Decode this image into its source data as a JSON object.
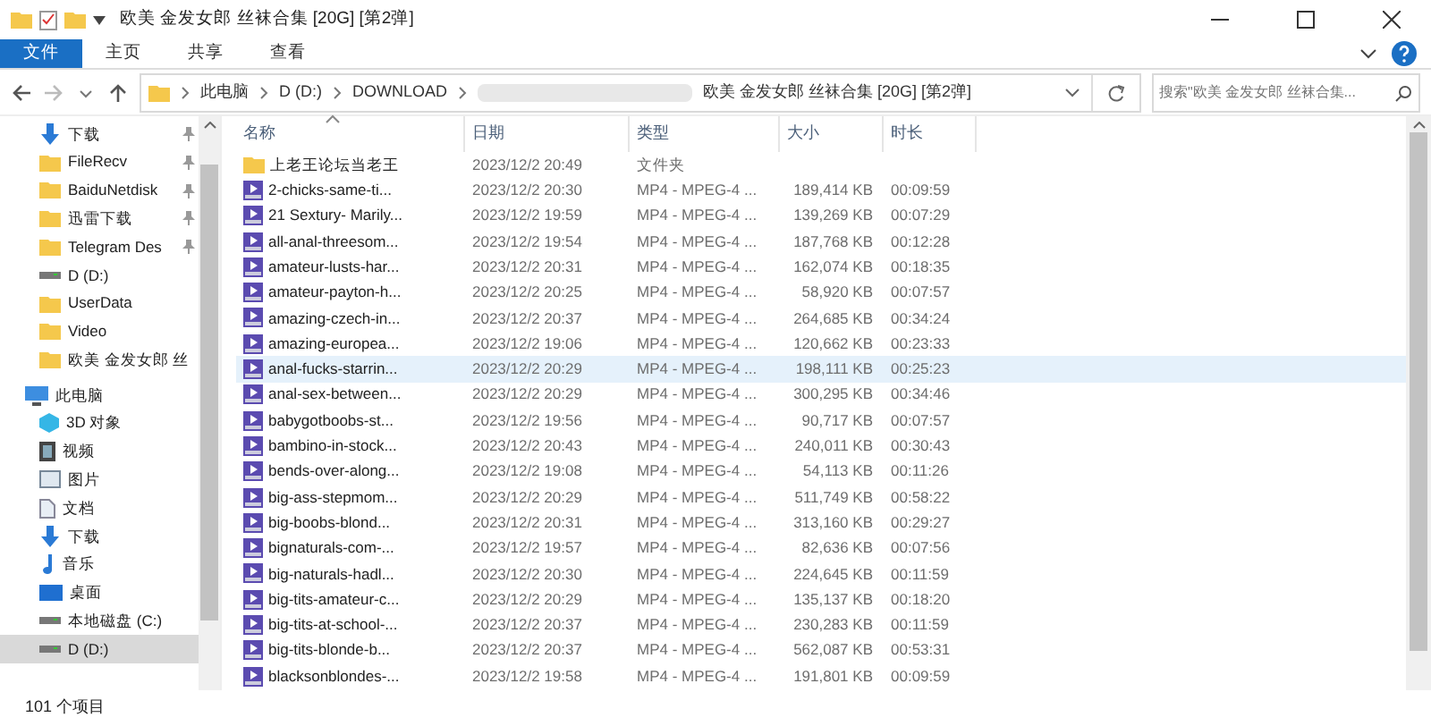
{
  "window": {
    "title": "欧美 金发女郎 丝袜合集 [20G] [第2弹]"
  },
  "ribbon_tabs": [
    {
      "label": "文件",
      "selected": true
    },
    {
      "label": "主页",
      "selected": false
    },
    {
      "label": "共享",
      "selected": false
    },
    {
      "label": "查看",
      "selected": false
    }
  ],
  "address": {
    "crumbs": [
      "此电脑",
      "D (D:)",
      "DOWNLOAD",
      "欧美 金发女郎 丝袜合集 [20G] [第2弹]"
    ]
  },
  "search": {
    "placeholder": "搜索\"欧美 金发女郎 丝袜合集..."
  },
  "sidebar": {
    "items": [
      {
        "label": "下载",
        "kind": "download",
        "pinned": true,
        "selected": false
      },
      {
        "label": "FileRecv",
        "kind": "folder",
        "pinned": true,
        "selected": false
      },
      {
        "label": "BaiduNetdisk",
        "kind": "folder",
        "pinned": true,
        "selected": false
      },
      {
        "label": "迅雷下载",
        "kind": "folder",
        "pinned": true,
        "selected": false
      },
      {
        "label": "Telegram Des",
        "kind": "folder",
        "pinned": true,
        "selected": false
      },
      {
        "label": "D (D:)",
        "kind": "drive",
        "pinned": false,
        "selected": false
      },
      {
        "label": "UserData",
        "kind": "folder",
        "pinned": false,
        "selected": false
      },
      {
        "label": "Video",
        "kind": "folder",
        "pinned": false,
        "selected": false
      },
      {
        "label": "欧美 金发女郎 丝",
        "kind": "folder",
        "pinned": false,
        "selected": false
      },
      {
        "label": "此电脑",
        "kind": "pc",
        "pinned": false,
        "selected": false,
        "children": [
          {
            "label": "3D 对象",
            "kind": "cube",
            "pinned": false,
            "selected": false
          },
          {
            "label": "视频",
            "kind": "film",
            "pinned": false,
            "selected": false
          },
          {
            "label": "图片",
            "kind": "picture",
            "pinned": false,
            "selected": false
          },
          {
            "label": "文档",
            "kind": "document",
            "pinned": false,
            "selected": false
          },
          {
            "label": "下载",
            "kind": "download",
            "pinned": false,
            "selected": false
          },
          {
            "label": "音乐",
            "kind": "music",
            "pinned": false,
            "selected": false
          },
          {
            "label": "桌面",
            "kind": "desktop",
            "pinned": false,
            "selected": false
          },
          {
            "label": "本地磁盘 (C:)",
            "kind": "drive",
            "pinned": false,
            "selected": false
          },
          {
            "label": "D (D:)",
            "kind": "drive",
            "pinned": false,
            "selected": true
          }
        ]
      }
    ]
  },
  "table": {
    "columns": [
      "名称",
      "日期",
      "类型",
      "大小",
      "时长"
    ],
    "rows": [
      {
        "kind": "folder",
        "selected": false,
        "cells": [
          "上老王论坛当老王",
          "2023/12/2 20:49",
          "文件夹"
        ]
      },
      {
        "kind": "video",
        "selected": false,
        "cells": [
          "2-chicks-same-ti...",
          "2023/12/2 20:30",
          "MP4 - MPEG-4 ...",
          "189,414 KB",
          "00:09:59"
        ]
      },
      {
        "kind": "video",
        "selected": false,
        "cells": [
          "21 Sextury- Marily...",
          "2023/12/2 19:59",
          "MP4 - MPEG-4 ...",
          "139,269 KB",
          "00:07:29"
        ]
      },
      {
        "kind": "video",
        "selected": false,
        "cells": [
          "all-anal-threesom...",
          "2023/12/2 19:54",
          "MP4 - MPEG-4 ...",
          "187,768 KB",
          "00:12:28"
        ]
      },
      {
        "kind": "video",
        "selected": false,
        "cells": [
          "amateur-lusts-har...",
          "2023/12/2 20:31",
          "MP4 - MPEG-4 ...",
          "162,074 KB",
          "00:18:35"
        ]
      },
      {
        "kind": "video",
        "selected": false,
        "cells": [
          "amateur-payton-h...",
          "2023/12/2 20:25",
          "MP4 - MPEG-4 ...",
          "58,920 KB",
          "00:07:57"
        ]
      },
      {
        "kind": "video",
        "selected": false,
        "cells": [
          "amazing-czech-in...",
          "2023/12/2 20:37",
          "MP4 - MPEG-4 ...",
          "264,685 KB",
          "00:34:24"
        ]
      },
      {
        "kind": "video",
        "selected": false,
        "cells": [
          "amazing-europea...",
          "2023/12/2 19:06",
          "MP4 - MPEG-4 ...",
          "120,662 KB",
          "00:23:33"
        ]
      },
      {
        "kind": "video",
        "selected": true,
        "cells": [
          "anal-fucks-starrin...",
          "2023/12/2 20:29",
          "MP4 - MPEG-4 ...",
          "198,111 KB",
          "00:25:23"
        ]
      },
      {
        "kind": "video",
        "selected": false,
        "cells": [
          "anal-sex-between...",
          "2023/12/2 20:29",
          "MP4 - MPEG-4 ...",
          "300,295 KB",
          "00:34:46"
        ]
      },
      {
        "kind": "video",
        "selected": false,
        "cells": [
          "babygotboobs-st...",
          "2023/12/2 19:56",
          "MP4 - MPEG-4 ...",
          "90,717 KB",
          "00:07:57"
        ]
      },
      {
        "kind": "video",
        "selected": false,
        "cells": [
          "bambino-in-stock...",
          "2023/12/2 20:43",
          "MP4 - MPEG-4 ...",
          "240,011 KB",
          "00:30:43"
        ]
      },
      {
        "kind": "video",
        "selected": false,
        "cells": [
          "bends-over-along...",
          "2023/12/2 19:08",
          "MP4 - MPEG-4 ...",
          "54,113 KB",
          "00:11:26"
        ]
      },
      {
        "kind": "video",
        "selected": false,
        "cells": [
          "big-ass-stepmom...",
          "2023/12/2 20:29",
          "MP4 - MPEG-4 ...",
          "511,749 KB",
          "00:58:22"
        ]
      },
      {
        "kind": "video",
        "selected": false,
        "cells": [
          "big-boobs-blond...",
          "2023/12/2 20:31",
          "MP4 - MPEG-4 ...",
          "313,160 KB",
          "00:29:27"
        ]
      },
      {
        "kind": "video",
        "selected": false,
        "cells": [
          "bignaturals-com-...",
          "2023/12/2 19:57",
          "MP4 - MPEG-4 ...",
          "82,636 KB",
          "00:07:56"
        ]
      },
      {
        "kind": "video",
        "selected": false,
        "cells": [
          "big-naturals-hadl...",
          "2023/12/2 20:30",
          "MP4 - MPEG-4 ...",
          "224,645 KB",
          "00:11:59"
        ]
      },
      {
        "kind": "video",
        "selected": false,
        "cells": [
          "big-tits-amateur-c...",
          "2023/12/2 20:29",
          "MP4 - MPEG-4 ...",
          "135,137 KB",
          "00:18:20"
        ]
      },
      {
        "kind": "video",
        "selected": false,
        "cells": [
          "big-tits-at-school-...",
          "2023/12/2 20:37",
          "MP4 - MPEG-4 ...",
          "230,283 KB",
          "00:11:59"
        ]
      },
      {
        "kind": "video",
        "selected": false,
        "cells": [
          "big-tits-blonde-b...",
          "2023/12/2 20:37",
          "MP4 - MPEG-4 ...",
          "562,087 KB",
          "00:53:31"
        ]
      },
      {
        "kind": "video",
        "selected": false,
        "cells": [
          "blacksonblondes-...",
          "2023/12/2 19:58",
          "MP4 - MPEG-4 ...",
          "191,801 KB",
          "00:09:59"
        ]
      }
    ]
  },
  "status_bar": {
    "count": "101 个项目"
  }
}
